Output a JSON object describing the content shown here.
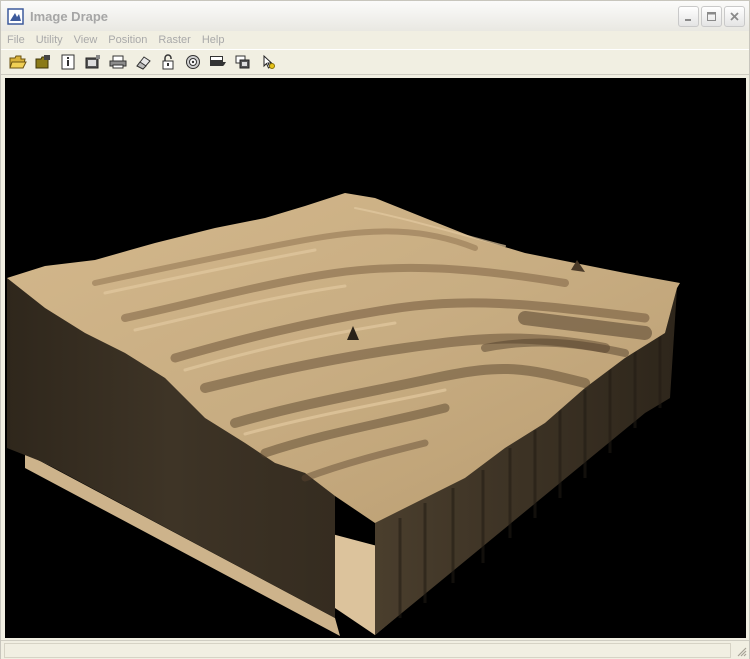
{
  "window": {
    "title": "Image Drape"
  },
  "menu": {
    "items": [
      "File",
      "Utility",
      "View",
      "Position",
      "Raster",
      "Help"
    ]
  },
  "toolbar": {
    "buttons": [
      "open-folder-icon",
      "open-image-icon",
      "info-icon",
      "film-icon",
      "printer-icon",
      "eraser-icon",
      "lock-icon",
      "target-icon",
      "display-icon",
      "layers-icon",
      "pointer-icon"
    ]
  },
  "colors": {
    "terrain_top": "#c9ad83",
    "terrain_wall": "#3b3124",
    "floor": "#dcc39c",
    "viewport_bg": "#000000"
  },
  "statusbar": {
    "text": ""
  }
}
